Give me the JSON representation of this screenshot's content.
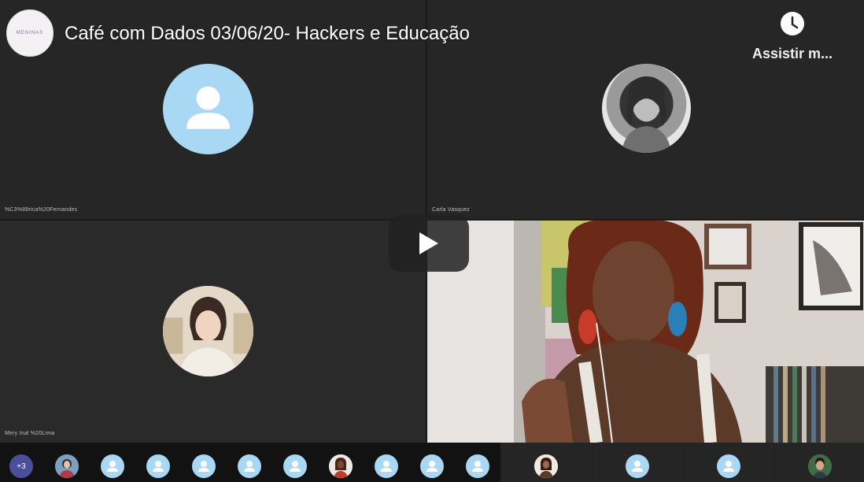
{
  "video": {
    "title": "Café com Dados 03/06/20- Hackers e Educação",
    "watch_later_label": "Assistir m...",
    "channel_logo_text": "MENINAS"
  },
  "tiles": [
    {
      "name": "%C3%89rica%20Fernandes",
      "avatar": "default-person-icon"
    },
    {
      "name": "Carla Vasquez",
      "avatar": "photo"
    },
    {
      "name": "Mery Inal %20Lima",
      "avatar": "photo"
    },
    {
      "name": "",
      "avatar": "live-video"
    }
  ],
  "strip": {
    "more_count": "+3"
  },
  "colors": {
    "avatar_bg": "#a9d8f5",
    "more_badge": "#4a4f9c",
    "tile_bg": "#2a2a2a"
  }
}
